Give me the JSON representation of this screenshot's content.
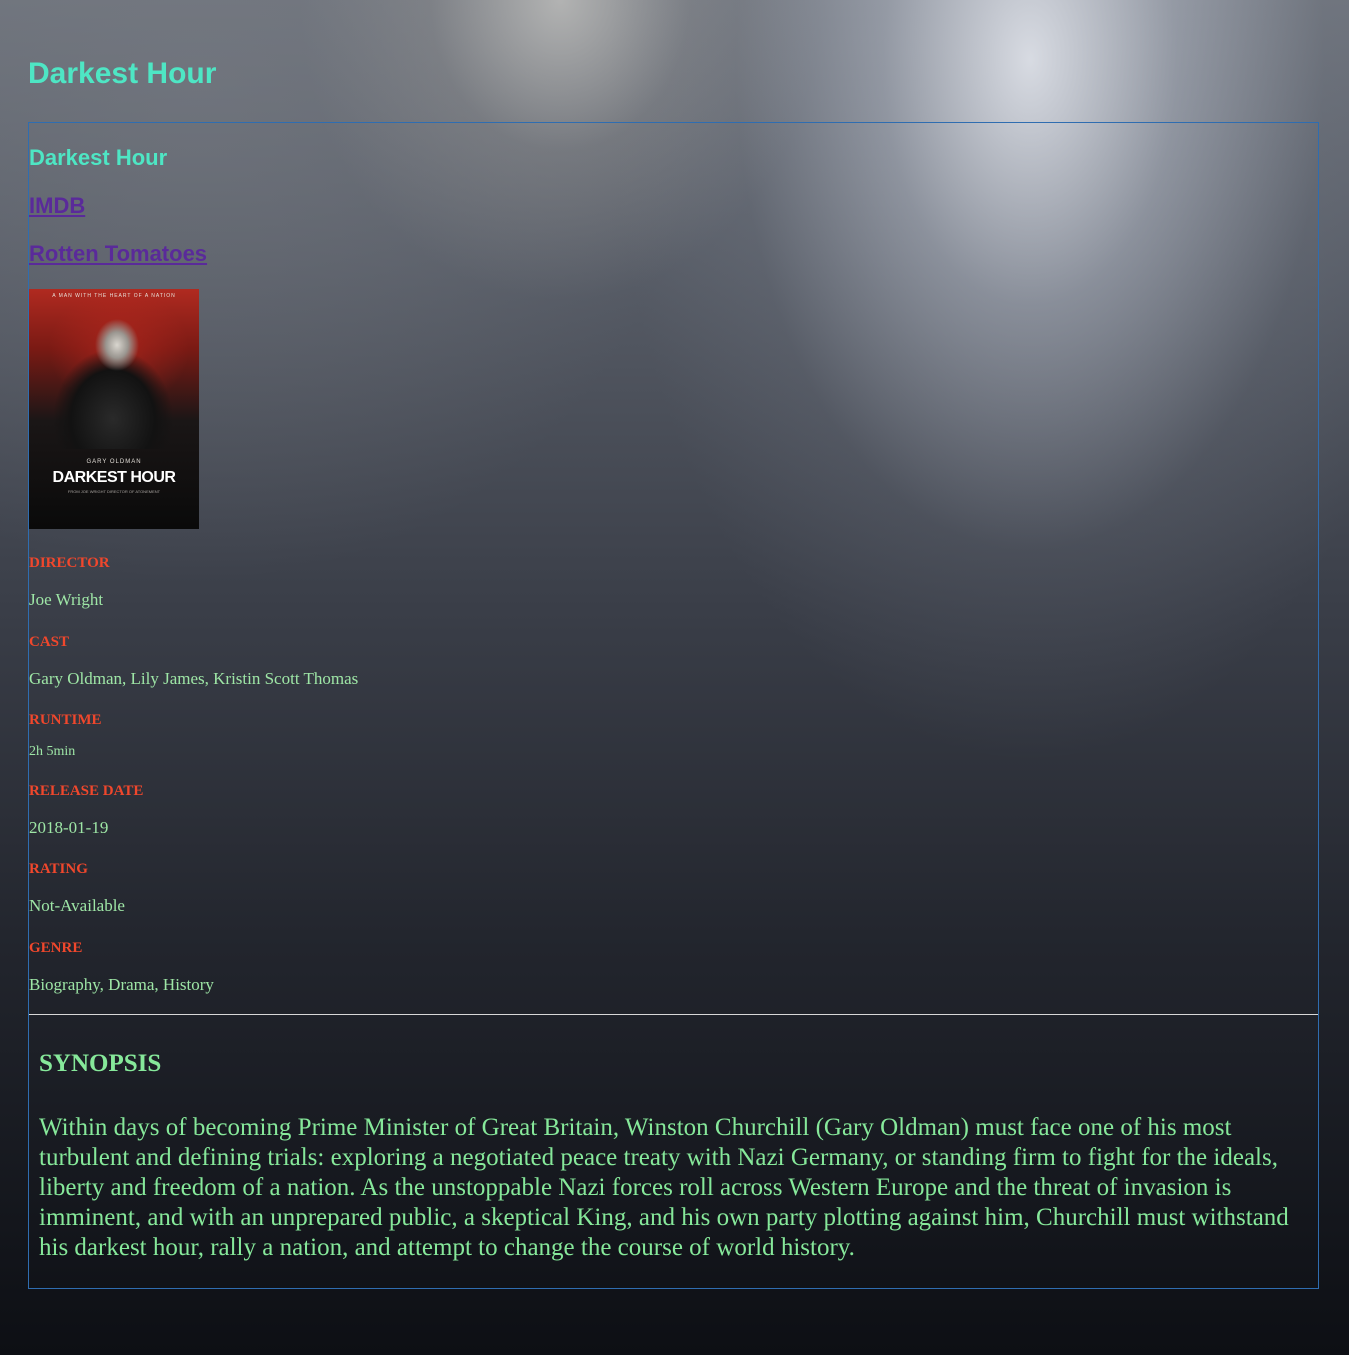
{
  "page": {
    "title": "Darkest Hour"
  },
  "movie": {
    "title": "Darkest Hour",
    "links": {
      "imdb": "IMDB",
      "rotten_tomatoes": "Rotten Tomatoes"
    },
    "poster": {
      "tagline": "A MAN WITH THE HEART OF A NATION",
      "actor": "GARY OLDMAN",
      "title": "DARKEST HOUR",
      "subtitle": "FROM JOE WRIGHT DIRECTOR OF ATONEMENT"
    },
    "details": [
      {
        "label": "DIRECTOR",
        "value": "Joe Wright"
      },
      {
        "label": "CAST",
        "value": "Gary Oldman, Lily James, Kristin Scott Thomas"
      },
      {
        "label": "RUNTIME",
        "value": "2h 5min"
      },
      {
        "label": "RELEASE DATE",
        "value": "2018-01-19"
      },
      {
        "label": "RATING",
        "value": "Not-Available"
      },
      {
        "label": "GENRE",
        "value": "Biography, Drama, History"
      }
    ],
    "synopsis": {
      "heading": "SYNOPSIS",
      "text": "Within days of becoming Prime Minister of Great Britain, Winston Churchill (Gary Oldman) must face one of his most turbulent and defining trials: exploring a negotiated peace treaty with Nazi Germany, or standing firm to fight for the ideals, liberty and freedom of a nation. As the unstoppable Nazi forces roll across Western Europe and the threat of invasion is imminent, and with an unprepared public, a skeptical King, and his own party plotting against him, Churchill must withstand his darkest hour, rally a nation, and attempt to change the course of world history."
    }
  },
  "colors": {
    "heading": "#4ee6c4",
    "link": "#5a2a9a",
    "label": "#f0472c",
    "value": "#9ee6a6",
    "border": "#2f6db0"
  }
}
